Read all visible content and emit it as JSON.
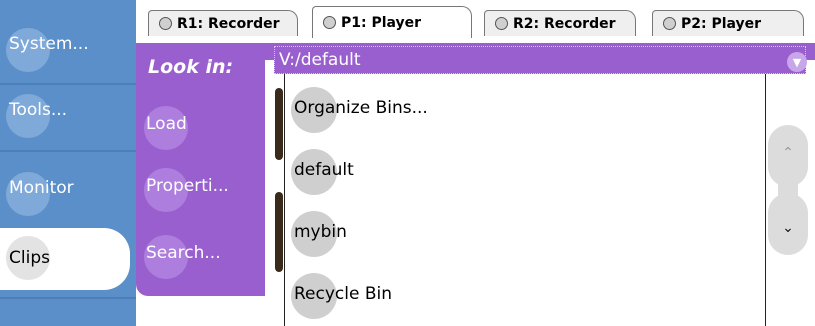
{
  "sidebar": {
    "items": [
      {
        "label": "System..."
      },
      {
        "label": "Tools..."
      },
      {
        "label": "Monitor"
      },
      {
        "label": "Clips"
      }
    ]
  },
  "tabs": [
    {
      "label": "R1: Recorder",
      "active": false
    },
    {
      "label": "P1: Player",
      "active": true
    },
    {
      "label": "R2: Recorder",
      "active": false
    },
    {
      "label": "P2: Player",
      "active": false
    }
  ],
  "panel": {
    "look_in_label": "Look in:",
    "path_value": "V:/default",
    "buttons": [
      {
        "label": "Load"
      },
      {
        "label": "Properti..."
      },
      {
        "label": "Search..."
      }
    ]
  },
  "dropdown": {
    "items": [
      {
        "label": "Organize Bins..."
      },
      {
        "label": "default"
      },
      {
        "label": "mybin"
      },
      {
        "label": "Recycle Bin"
      }
    ]
  },
  "icons": {
    "combo_arrow": "chevron-down-icon",
    "scroll_up": "chevron-up-icon",
    "scroll_down": "chevron-down-icon"
  },
  "colors": {
    "sidebar": "#5b8fc9",
    "panel": "#9a5fcf",
    "dropdown_bubble": "#cfcfcf"
  }
}
